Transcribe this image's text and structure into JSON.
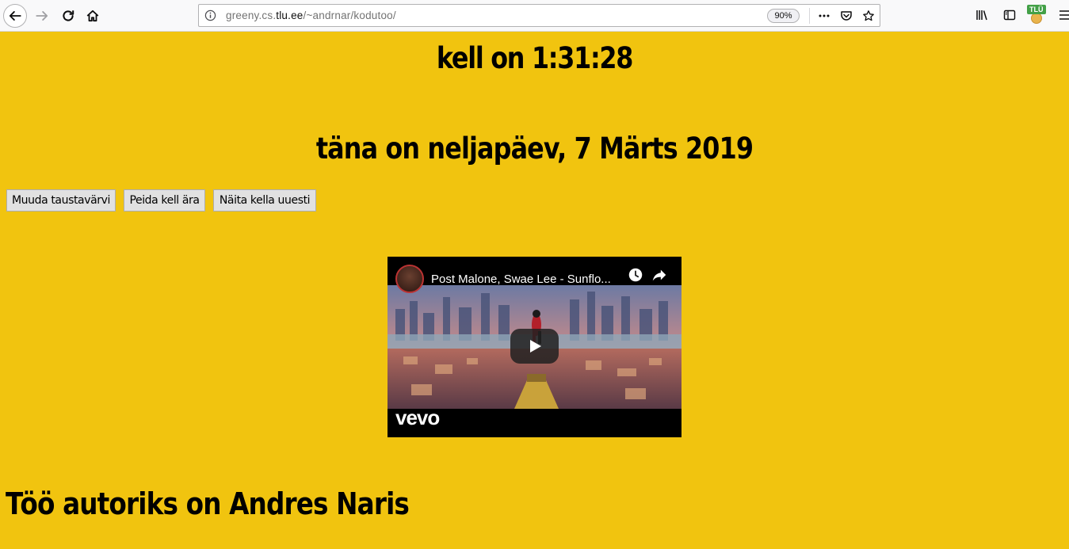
{
  "browser": {
    "url_prefix": "greeny.cs.",
    "url_domain": "tlu.ee",
    "url_path": "/~andrnar/kodutoo/",
    "zoom": "90%",
    "extension_badge": "TLÜ"
  },
  "page": {
    "clock": "kell on 1:31:28",
    "date": "täna on neljapäev, 7 Märts 2019",
    "buttons": {
      "change_bg": "Muuda taustavärvi",
      "hide_clock": "Peida kell ära",
      "show_clock": "Näita kella uuesti"
    },
    "video": {
      "title": "Post Malone, Swae Lee - Sunflo...",
      "logo": "vevo"
    },
    "author": "Töö autoriks on Andres Naris"
  },
  "colors": {
    "background": "#f1c40f"
  }
}
